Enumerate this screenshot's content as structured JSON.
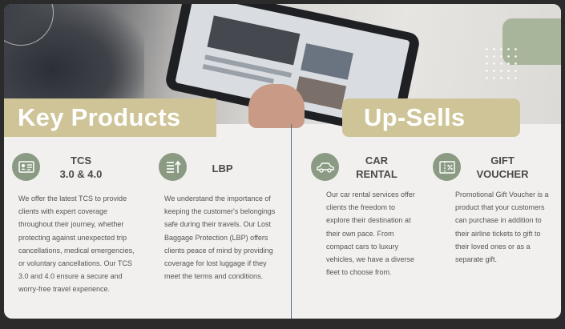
{
  "sections": {
    "key_products": {
      "title": "Key Products"
    },
    "up_sells": {
      "title": "Up-Sells"
    }
  },
  "key_products": [
    {
      "icon": "id-card-icon",
      "title_line1": "TCS",
      "title_line2": "3.0 & 4.0",
      "description": "We offer the latest TCS to provide clients with expert coverage throughout their journey, whether protecting against unexpected trip cancellations, medical emergencies, or voluntary cancellations. Our TCS 3.0 and 4.0 ensure a secure and worry-free travel experience."
    },
    {
      "icon": "luggage-list-icon",
      "title_line1": "LBP",
      "description": "We understand the importance of keeping the customer's belongings safe during their travels. Our Lost Baggage Protection (LBP) offers clients peace of mind by providing coverage for lost luggage if they meet the terms and conditions."
    }
  ],
  "up_sells": [
    {
      "icon": "car-icon",
      "title_line1": "CAR",
      "title_line2": "RENTAL",
      "description": "Our car rental services offer clients the freedom to explore their destination at their own pace. From compact cars to luxury vehicles, we have a diverse fleet to choose from."
    },
    {
      "icon": "gift-voucher-icon",
      "title_line1": "GIFT",
      "title_line2": "VOUCHER",
      "description": "Promotional Gift Voucher is a product that your customers can purchase in addition to their airline tickets to gift to their loved ones or as a separate gift."
    }
  ],
  "colors": {
    "accent_gold": "#cfc497",
    "icon_green": "#8b9b83",
    "divider": "#5d6f85",
    "text": "#555555"
  }
}
